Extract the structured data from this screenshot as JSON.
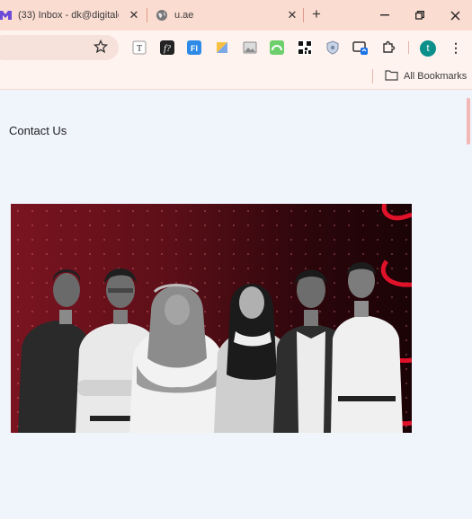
{
  "browser": {
    "tabs": [
      {
        "title": "(33) Inbox - dk@digitalgr",
        "favicon": "mail-icon"
      },
      {
        "title": "u.ae",
        "favicon": "globe-icon"
      }
    ],
    "bookmarks": {
      "all_label": "All Bookmarks"
    },
    "profile_initial": "t",
    "accent_color": "#fbdcd1"
  },
  "page": {
    "heading": "Contact Us",
    "hero_image": {
      "description_icon": "team-photo-image",
      "background_color": "#7a1420",
      "accent_color": "#e0122a"
    }
  }
}
